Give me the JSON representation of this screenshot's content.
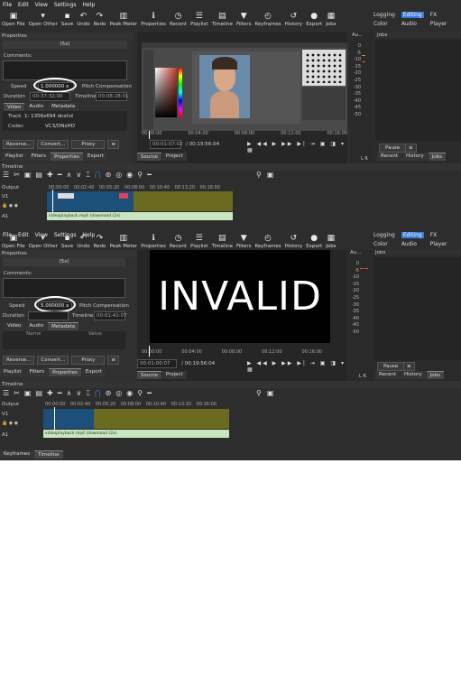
{
  "menu": [
    "File",
    "Edit",
    "View",
    "Settings",
    "Help"
  ],
  "toolbar": [
    {
      "label": "Open File",
      "icon": "open-file-icon",
      "glyph": "▣"
    },
    {
      "label": "Open Other",
      "icon": "open-other-icon",
      "glyph": "▾"
    },
    {
      "label": "Save",
      "icon": "save-icon",
      "glyph": "▪"
    },
    {
      "label": "Undo",
      "icon": "undo-icon",
      "glyph": "↶"
    },
    {
      "label": "Redo",
      "icon": "redo-icon",
      "glyph": "↷"
    },
    {
      "label": "Peak Meter",
      "icon": "peak-meter-icon",
      "glyph": "▥"
    },
    {
      "label": "Properties",
      "icon": "properties-icon",
      "glyph": "ℹ"
    },
    {
      "label": "Recent",
      "icon": "recent-icon",
      "glyph": "◷"
    },
    {
      "label": "Playlist",
      "icon": "playlist-icon",
      "glyph": "☰"
    },
    {
      "label": "Timeline",
      "icon": "timeline-icon",
      "glyph": "▤"
    },
    {
      "label": "Filters",
      "icon": "filters-icon",
      "glyph": "▼"
    },
    {
      "label": "Keyframes",
      "icon": "keyframes-icon",
      "glyph": "◴"
    },
    {
      "label": "History",
      "icon": "history-icon",
      "glyph": "↺"
    },
    {
      "label": "Export",
      "icon": "export-icon",
      "glyph": "●"
    },
    {
      "label": "Jobs",
      "icon": "jobs-icon",
      "glyph": "▦"
    }
  ],
  "layouts": [
    "Logging",
    "Editing",
    "FX",
    "Color",
    "Audio",
    "Player"
  ],
  "colors": {
    "accent": "#3a7bd5",
    "timeline_track": "#6b6b1f",
    "clip_blue": "#1c4f7a",
    "audio_clip": "#c8e6c0"
  },
  "shot1": {
    "properties_title": "Properties",
    "speed_badge": "(5x)",
    "comments_label": "Comments:",
    "speed_label": "Speed",
    "speed_value": "1.000000 x",
    "pitch_label": "Pitch Compensation",
    "duration_label": "Duration",
    "duration_value": "00:37:32:00",
    "timeline_label": "Timeline",
    "timeline_value": "00:08:28:01",
    "tabs": [
      "Video",
      "Audio",
      "Metadata"
    ],
    "track_label": "Track",
    "track_value": "1: 1356x694 dnxhd",
    "codec_label": "Codec",
    "codec_value": "VC3/DNxHD",
    "buttons": [
      "Reverse...",
      "Convert...",
      "Proxy"
    ],
    "bottom_tabs": [
      "Playlist",
      "Filters",
      "Properties",
      "Export"
    ],
    "source_tabs": [
      "Source",
      "Project"
    ],
    "ruler": [
      "00:00:00",
      "00:04:00",
      "00:08:00",
      "00:12:00",
      "00:16:00"
    ],
    "position": "00:01:07:02",
    "total": "/ 00:19:56:04",
    "audio_title": "Au...",
    "jobs_title": "Jobs",
    "meter": [
      "0",
      "-5",
      "-10",
      "-15",
      "-20",
      "-25",
      "-30",
      "-35",
      "-40",
      "-45",
      "-50"
    ],
    "lr": "L R",
    "pause": "Pause",
    "right_tabs": [
      "Recent",
      "History",
      "Jobs"
    ],
    "timeline_title": "Timeline",
    "output_label": "Output",
    "v1_label": "V1",
    "a1_label": "A1",
    "tl_ruler": [
      "00:00:00",
      "00:02:40",
      "00:05:20",
      "00:08:00",
      "00:10:40",
      "00:13:20",
      "00:16:00"
    ],
    "clip_name": "videoplayback.mp4 (download (2x)"
  },
  "shot2": {
    "properties_title": "Properties",
    "speed_badge": "(5x)",
    "comments_label": "Comments:",
    "speed_label": "Speed",
    "speed_value": "5.000000 x",
    "pitch_label": "Pitch Compensation",
    "duration_label": "Duration",
    "timeline_label": "Timeline",
    "timeline_value": "00:01:41:07",
    "tabs": [
      "Video",
      "Audio",
      "Metadata"
    ],
    "meta_cols": [
      "Name",
      "Value"
    ],
    "buttons": [
      "Reverse...",
      "Convert...",
      "Proxy"
    ],
    "bottom_tabs": [
      "Playlist",
      "Filters",
      "Properties",
      "Export"
    ],
    "source_tabs": [
      "Source",
      "Project"
    ],
    "invalid_text": "INVALID",
    "ruler": [
      "00:00:00",
      "00:04:00",
      "00:08:00",
      "00:12:00",
      "00:16:00"
    ],
    "position": "00:01:00:07",
    "total": "/ 00:19:56:04",
    "audio_title": "Au...",
    "jobs_title": "Jobs",
    "meter": [
      "0",
      "-5",
      "-10",
      "-15",
      "-20",
      "-25",
      "-30",
      "-35",
      "-40",
      "-45",
      "-50"
    ],
    "lr": "L R",
    "pause": "Pause",
    "right_tabs": [
      "Recent",
      "History",
      "Jobs"
    ],
    "timeline_title": "Timeline",
    "output_label": "Output",
    "v1_label": "V1",
    "a1_label": "A1",
    "tl_ruler": [
      "00:00:00",
      "00:02:40",
      "00:05:20",
      "00:08:00",
      "00:10:40",
      "00:13:20",
      "00:16:00"
    ],
    "clip_name": "videoplayback.mp4 (download (2x)",
    "footer_tabs": [
      "Keyframes",
      "Timeline"
    ]
  }
}
